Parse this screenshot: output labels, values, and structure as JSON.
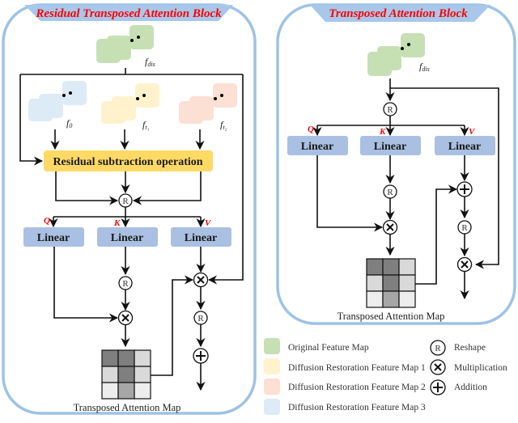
{
  "colors": {
    "frame": "#9DC3E6",
    "title_tab": "#A7C8EA",
    "title_text": "#ff0000",
    "linear_box": "#A9C0E2",
    "residual_box": "#FFD966",
    "green": "#C6E0B4",
    "yellow": "#FFF2CC",
    "salmon": "#FBE0D3",
    "blue": "#DDEBF7",
    "cell_dark": "#7F7F7F",
    "cell_mid": "#A6A6A6",
    "cell_light": "#D9D9D9",
    "cell_lighter": "#EDEDED"
  },
  "left_block": {
    "title": "Residual Transposed Attention Block",
    "input_label": "f",
    "input_sub": "dis",
    "features": [
      {
        "label": "f",
        "sub": "0",
        "color": "blue"
      },
      {
        "label": "f",
        "sub": "t₁",
        "color": "yellow"
      },
      {
        "label": "f",
        "sub": "t₂",
        "color": "salmon"
      }
    ],
    "residual_op": "Residual subtraction operation",
    "qkv": [
      "Q",
      "K",
      "V"
    ],
    "linear": [
      "Linear",
      "Linear",
      "Linear"
    ],
    "reshape_symbol": "R",
    "map_caption": "Transposed Attention Map",
    "attention_map": [
      [
        "dark",
        "dark",
        "light"
      ],
      [
        "light",
        "dark",
        "light"
      ],
      [
        "lighter",
        "mid",
        "lighter"
      ]
    ]
  },
  "right_block": {
    "title": "Transposed Attention Block",
    "input_label": "f",
    "input_sub": "dis",
    "qkv": [
      "Q",
      "K",
      "V"
    ],
    "linear": [
      "Linear",
      "Linear",
      "Linear"
    ],
    "reshape_symbol": "R",
    "map_caption": "Transposed Attention Map",
    "attention_map": [
      [
        "dark",
        "dark",
        "light"
      ],
      [
        "light",
        "dark",
        "light"
      ],
      [
        "lighter",
        "mid",
        "lighter"
      ]
    ]
  },
  "legend": {
    "colors": [
      {
        "label": "Original Feature Map",
        "color": "green"
      },
      {
        "label": "Diffusion Restoration Feature Map 1",
        "color": "yellow"
      },
      {
        "label": "Diffusion Restoration Feature Map 2",
        "color": "salmon"
      },
      {
        "label": "Diffusion Restoration Feature Map 3",
        "color": "blue"
      }
    ],
    "ops": [
      {
        "symbol": "reshape",
        "glyph": "R",
        "label": "Reshape"
      },
      {
        "symbol": "multiplication",
        "glyph": "×",
        "label": "Multiplication"
      },
      {
        "symbol": "addition",
        "glyph": "+",
        "label": "Addition"
      }
    ]
  }
}
